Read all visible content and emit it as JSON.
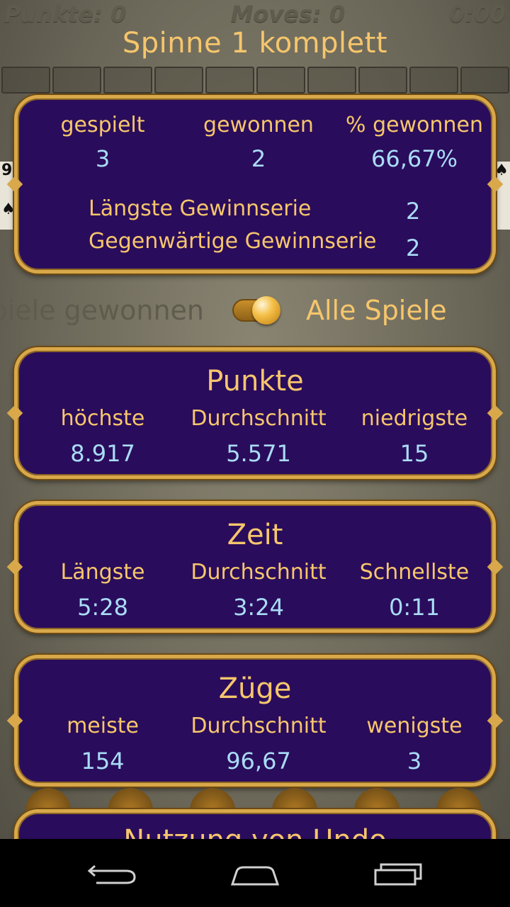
{
  "topbar": {
    "punkte": "Punkte: 0",
    "moves": "Moves: 0",
    "time": "0:00"
  },
  "title": "Spinne 1 komplett",
  "background_cards": {
    "left_rank": "9",
    "left_suit": "♠",
    "right_suit": "♠"
  },
  "summary": {
    "headers": [
      "gespielt",
      "gewonnen",
      "% gewonnen"
    ],
    "values": [
      "3",
      "2",
      "66,67%"
    ],
    "streaks": [
      {
        "label": "Längste Gewinnserie",
        "value": "2"
      },
      {
        "label": "Gegenwärtige Gewinnserie",
        "value": "2"
      }
    ]
  },
  "filter": {
    "left_label": "piele gewonnen",
    "right_label": "Alle Spiele",
    "toggle_state": "right"
  },
  "panels": [
    {
      "title": "Punkte",
      "headers": [
        "höchste",
        "Durchschnitt",
        "niedrigste"
      ],
      "values": [
        "8.917",
        "5.571",
        "15"
      ]
    },
    {
      "title": "Zeit",
      "headers": [
        "Längste",
        "Durchschnitt",
        "Schnellste"
      ],
      "values": [
        "5:28",
        "3:24",
        "0:11"
      ]
    },
    {
      "title": "Züge",
      "headers": [
        "meiste",
        "Durchschnitt",
        "wenigste"
      ],
      "values": [
        "154",
        "96,67",
        "3"
      ]
    }
  ],
  "partial_panel": {
    "title": "Nutzung von Undo"
  },
  "navbar": {
    "icons": [
      "back-icon",
      "home-icon",
      "recent-apps-icon"
    ]
  },
  "colors": {
    "panel_bg": "#2a0c5c",
    "gold_text": "#f6c66c",
    "value_text": "#a9dcf6",
    "border_gold": "#d8a84a"
  }
}
